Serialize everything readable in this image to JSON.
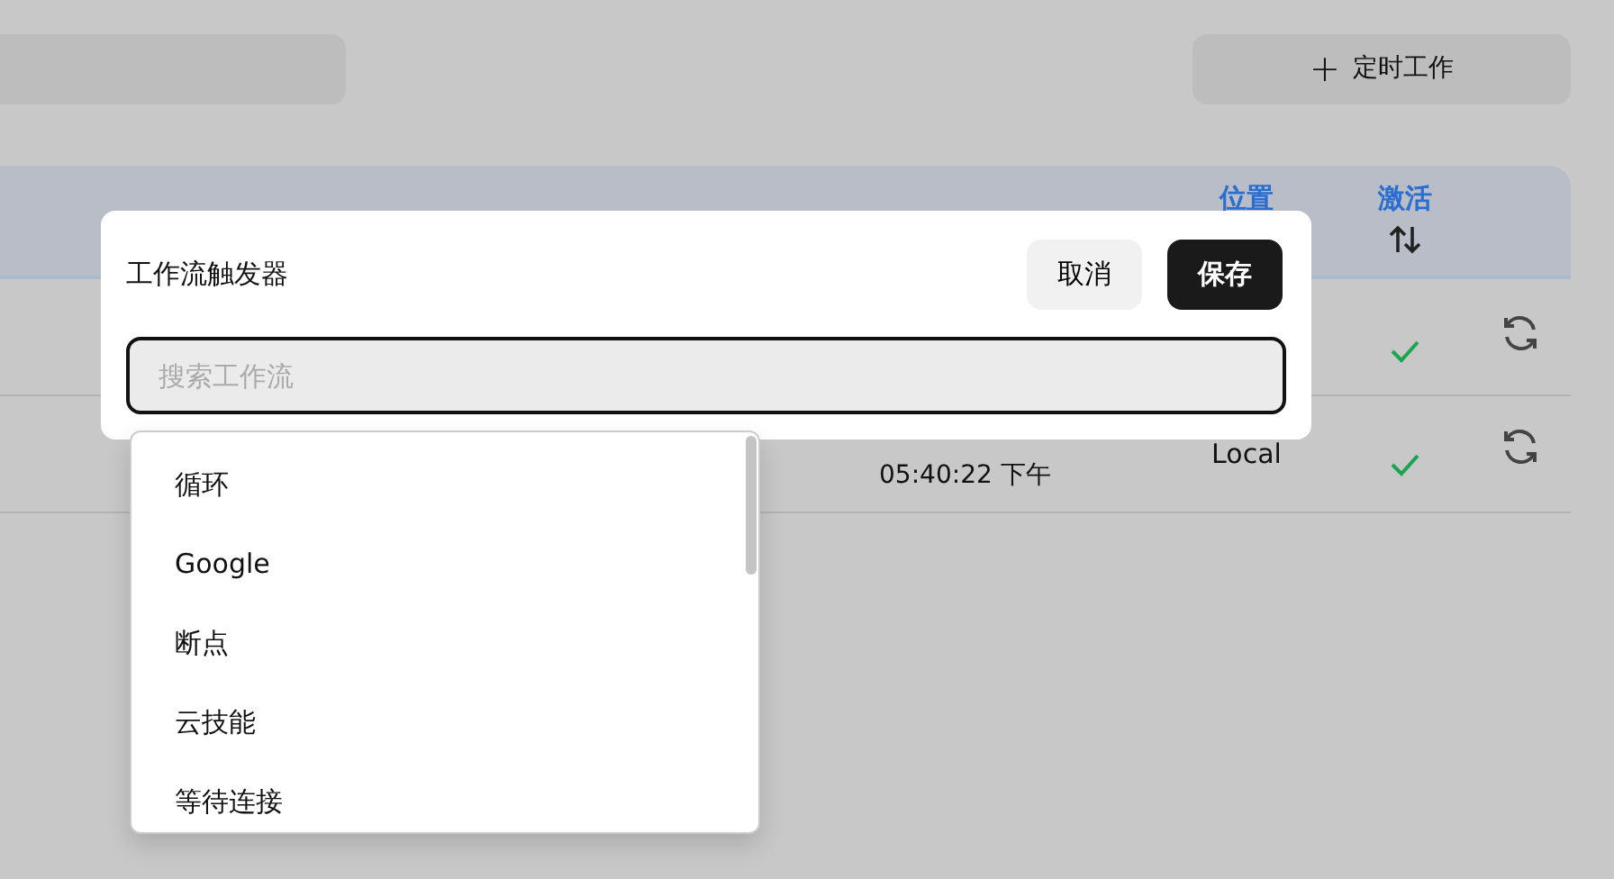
{
  "page": {
    "add_button": {
      "icon": "+",
      "label": "定时工作"
    },
    "table": {
      "columns": [
        {
          "label": "位置",
          "kind": "plain"
        },
        {
          "label": "激活",
          "kind": "sortable"
        }
      ],
      "rows": [
        {
          "active": true
        },
        {
          "location": "Local",
          "time": "05:40:22 下午",
          "active": true
        }
      ]
    }
  },
  "dialog": {
    "title": "工作流触发器",
    "buttons": [
      {
        "label": "取消",
        "kind": "secondary"
      },
      {
        "label": "保存",
        "kind": "primary"
      }
    ],
    "search": {
      "placeholder": "搜索工作流"
    },
    "options": [
      "循环",
      "Google",
      "断点",
      "云技能",
      "等待连接"
    ]
  }
}
